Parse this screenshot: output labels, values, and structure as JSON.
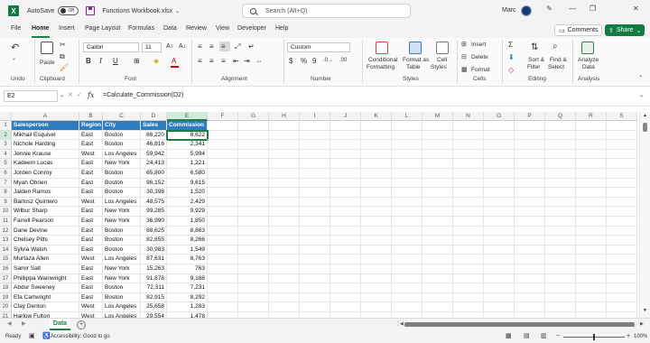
{
  "titlebar": {
    "autosave_label": "AutoSave",
    "autosave_state": "Off",
    "workbook_title": "Functions Workbook.xlsx",
    "search_placeholder": "Search (Alt+Q)",
    "user_name": "Marc"
  },
  "menu": {
    "tabs": [
      "File",
      "Home",
      "Insert",
      "Page Layout",
      "Formulas",
      "Data",
      "Review",
      "View",
      "Developer",
      "Help"
    ],
    "comments_label": "Comments",
    "share_label": "Share"
  },
  "ribbon": {
    "undo_label": "Undo",
    "clipboard_label": "Clipboard",
    "paste_label": "Paste",
    "font_name": "Calibri",
    "font_size": "11",
    "font_label": "Font",
    "alignment_label": "Alignment",
    "number_format": "Custom",
    "number_label": "Number",
    "conditional_formatting": [
      "Conditional",
      "Formatting"
    ],
    "format_as_table": [
      "Format as",
      "Table"
    ],
    "cell_styles": [
      "Cell",
      "Styles"
    ],
    "styles_label": "Styles",
    "insert_label": "Insert",
    "delete_label": "Delete",
    "format_label": "Format",
    "cells_label": "Cells",
    "sort_filter": [
      "Sort &",
      "Filter"
    ],
    "find_select": [
      "Find &",
      "Select"
    ],
    "editing_label": "Editing",
    "analyze_data": [
      "Analyze",
      "Data"
    ],
    "analysis_label": "Analysis"
  },
  "formula_bar": {
    "name_box": "E2",
    "fx": "fx",
    "formula": "=Calculate_Commission(D2)"
  },
  "grid": {
    "columns": [
      "A",
      "B",
      "C",
      "D",
      "E",
      "F",
      "G",
      "H",
      "I",
      "J",
      "K",
      "L",
      "M",
      "N",
      "O",
      "P",
      "Q",
      "R",
      "S"
    ],
    "rows": [
      "1",
      "2",
      "3",
      "4",
      "5",
      "6",
      "7",
      "8",
      "9",
      "10",
      "11",
      "12",
      "13",
      "14",
      "15",
      "16",
      "17",
      "18",
      "19",
      "20",
      "21"
    ],
    "header": [
      "Salesperson",
      "Region",
      "City",
      "Sales",
      "Commission"
    ],
    "data": [
      [
        "Mikhail Esquivel",
        "East",
        "Boston",
        "86,220",
        "8,622"
      ],
      [
        "Nichole Harding",
        "East",
        "Boston",
        "46,816",
        "2,341"
      ],
      [
        "Jennie Krause",
        "West",
        "Los Angeles",
        "59,942",
        "5,994"
      ],
      [
        "Kadeem Lucas",
        "East",
        "New York",
        "24,413",
        "1,221"
      ],
      [
        "Jorden Conroy",
        "East",
        "Boston",
        "65,800",
        "6,580"
      ],
      [
        "Myah Obrien",
        "East",
        "Boston",
        "96,152",
        "9,615"
      ],
      [
        "Jaiden Ramos",
        "East",
        "Boston",
        "30,398",
        "1,520"
      ],
      [
        "Bartosz Quintero",
        "West",
        "Los Angeles",
        "48,575",
        "2,429"
      ],
      [
        "Wilbur Sharp",
        "East",
        "New York",
        "99,285",
        "9,929"
      ],
      [
        "Farrell Pearson",
        "East",
        "New York",
        "36,990",
        "1,850"
      ],
      [
        "Dane Devine",
        "East",
        "Boston",
        "88,625",
        "8,863"
      ],
      [
        "Chelsey Pitts",
        "East",
        "Boston",
        "82,655",
        "8,266"
      ],
      [
        "Sylvia Walsh",
        "East",
        "Boston",
        "30,983",
        "1,549"
      ],
      [
        "Murtaza Allen",
        "West",
        "Los Angeles",
        "87,631",
        "8,763"
      ],
      [
        "Samir Salt",
        "East",
        "New York",
        "15,263",
        "763"
      ],
      [
        "Phillippa Wainwright",
        "East",
        "New York",
        "91,878",
        "9,188"
      ],
      [
        "Abdur Sweeney",
        "East",
        "Boston",
        "72,311",
        "7,231"
      ],
      [
        "Efa Cartwright",
        "East",
        "Boston",
        "82,915",
        "8,292"
      ],
      [
        "Clay Denton",
        "West",
        "Los Angeles",
        "25,658",
        "1,283"
      ],
      [
        "Harlow Fulton",
        "West",
        "Los Angeles",
        "29,554",
        "1,478"
      ]
    ]
  },
  "sheet_tabs": {
    "active": "Data",
    "add": "+"
  },
  "status": {
    "ready": "Ready",
    "accessibility": "Accessibility: Good to go",
    "zoom": "100%"
  },
  "colors": {
    "excel_green": "#107c41",
    "header_blue": "#2f7cc0"
  }
}
